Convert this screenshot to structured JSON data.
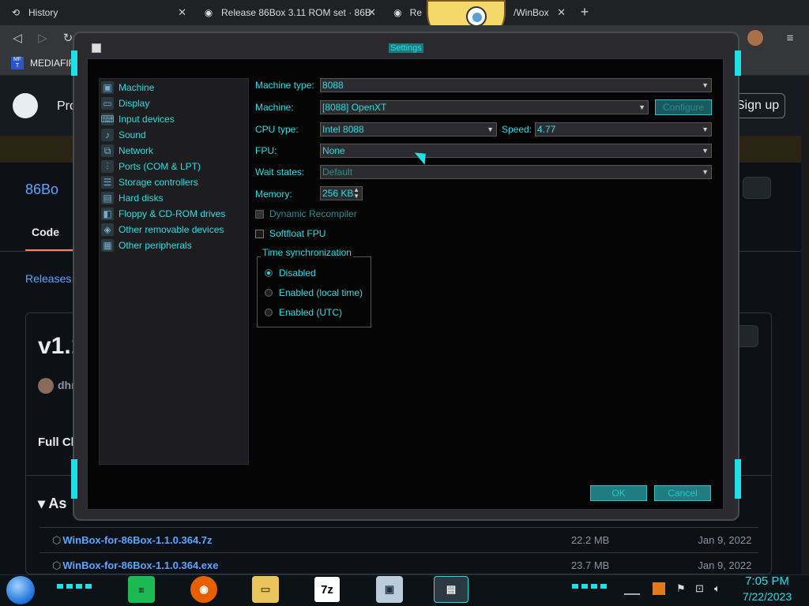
{
  "browser": {
    "tabs": [
      {
        "label": "History",
        "icon": "history-icon"
      },
      {
        "label": "Release 86Box 3.11 ROM set · 86B",
        "icon": "github-icon"
      },
      {
        "label": "Re",
        "icon": "github-icon"
      },
      {
        "label": "/WinBox",
        "icon": ""
      }
    ],
    "new_tab": "+",
    "bookmark": "MEDIAFIR"
  },
  "github": {
    "header_partial": "Pro",
    "sign_in": "Sign up",
    "repo_partial": "86Bo",
    "code_tab": "Code",
    "breadcrumb": "Releases",
    "release_title": "v1.1",
    "author_partial": "dhr",
    "full_changelog": "Full Ch",
    "assets_heading": "As",
    "assets": [
      {
        "name": "WinBox-for-86Box-1.1.0.364.7z",
        "size": "22.2 MB",
        "date": "Jan 9, 2022"
      },
      {
        "name": "WinBox-for-86Box-1.1.0.364.exe",
        "size": "23.7 MB",
        "date": "Jan 9, 2022"
      }
    ]
  },
  "dialog": {
    "title": "Settings",
    "sidebar": [
      {
        "label": "Machine",
        "icon": "machine-icon"
      },
      {
        "label": "Display",
        "icon": "display-icon"
      },
      {
        "label": "Input devices",
        "icon": "keyboard-icon"
      },
      {
        "label": "Sound",
        "icon": "sound-icon"
      },
      {
        "label": "Network",
        "icon": "network-icon"
      },
      {
        "label": "Ports (COM & LPT)",
        "icon": "ports-icon"
      },
      {
        "label": "Storage controllers",
        "icon": "storage-icon"
      },
      {
        "label": "Hard disks",
        "icon": "hard-disk-icon"
      },
      {
        "label": "Floppy & CD-ROM drives",
        "icon": "floppy-icon"
      },
      {
        "label": "Other removable devices",
        "icon": "removable-icon"
      },
      {
        "label": "Other peripherals",
        "icon": "peripherals-icon"
      }
    ],
    "machine_type_label": "Machine type:",
    "machine_type_value": "8088",
    "machine_label": "Machine:",
    "machine_value": "[8088] OpenXT",
    "configure": "Configure",
    "cpu_type_label": "CPU type:",
    "cpu_type_value": "Intel 8088",
    "speed_label": "Speed:",
    "speed_value": "4.77",
    "fpu_label": "FPU:",
    "fpu_value": "None",
    "wait_states_label": "Wait states:",
    "wait_states_value": "Default",
    "memory_label": "Memory:",
    "memory_value": "256 KB",
    "dynamic_recompiler": "Dynamic Recompiler",
    "softfloat_fpu": "Softfloat FPU",
    "time_sync_title": "Time synchronization",
    "time_sync_options": [
      "Disabled",
      "Enabled (local time)",
      "Enabled (UTC)"
    ],
    "time_sync_selected": "Disabled",
    "ok": "OK",
    "cancel": "Cancel"
  },
  "taskbar": {
    "time": "7:05 PM",
    "date": "7/22/2023",
    "apps": [
      "spotify",
      "firefox",
      "file-explorer",
      "7z",
      "86box",
      "winbox"
    ]
  }
}
